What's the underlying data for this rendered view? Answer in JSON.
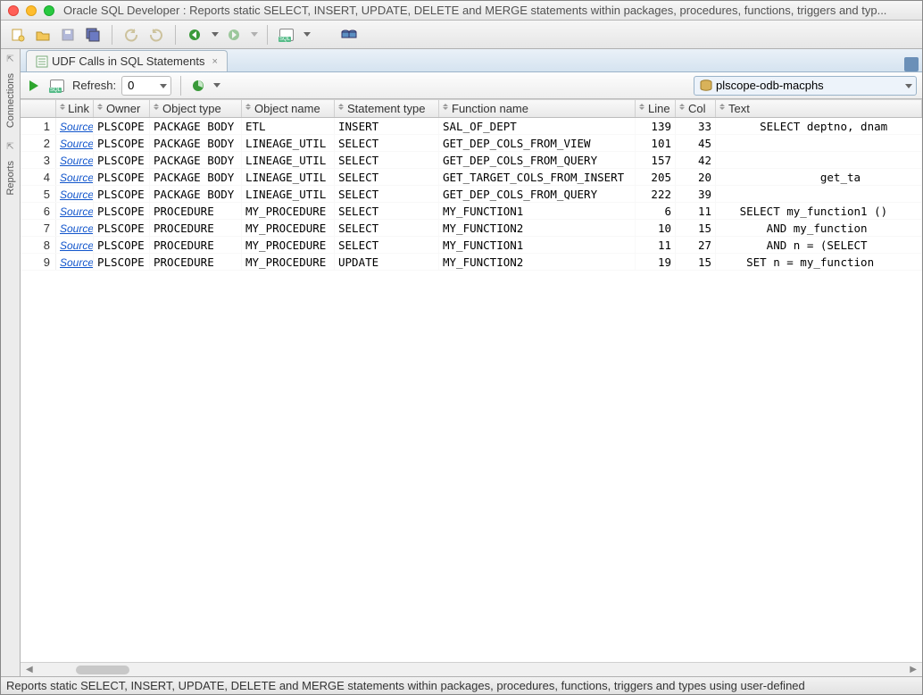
{
  "window_title": "Oracle SQL Developer : Reports static SELECT, INSERT, UPDATE, DELETE and MERGE statements within packages, procedures, functions, triggers and typ...",
  "sidetabs": {
    "connections": "Connections",
    "reports": "Reports"
  },
  "tab": {
    "label": "UDF Calls in SQL Statements"
  },
  "runbar": {
    "refresh_label": "Refresh:",
    "refresh_value": "0",
    "db_selected": "plscope-odb-macphs"
  },
  "columns": {
    "link": "Link",
    "owner": "Owner",
    "object_type": "Object type",
    "object_name": "Object name",
    "statement_type": "Statement type",
    "function_name": "Function name",
    "line": "Line",
    "col": "Col",
    "text": "Text"
  },
  "rows": [
    {
      "n": "1",
      "link": "Source",
      "owner": "PLSCOPE",
      "otype": "PACKAGE BODY",
      "oname": "ETL",
      "stmt": "INSERT",
      "func": "SAL_OF_DEPT",
      "line": "139",
      "col": "33",
      "text": "      SELECT deptno, dnam"
    },
    {
      "n": "2",
      "link": "Source",
      "owner": "PLSCOPE",
      "otype": "PACKAGE BODY",
      "oname": "LINEAGE_UTIL",
      "stmt": "SELECT",
      "func": "GET_DEP_COLS_FROM_VIEW",
      "line": "101",
      "col": "45",
      "text": ""
    },
    {
      "n": "3",
      "link": "Source",
      "owner": "PLSCOPE",
      "otype": "PACKAGE BODY",
      "oname": "LINEAGE_UTIL",
      "stmt": "SELECT",
      "func": "GET_DEP_COLS_FROM_QUERY",
      "line": "157",
      "col": "42",
      "text": ""
    },
    {
      "n": "4",
      "link": "Source",
      "owner": "PLSCOPE",
      "otype": "PACKAGE BODY",
      "oname": "LINEAGE_UTIL",
      "stmt": "SELECT",
      "func": "GET_TARGET_COLS_FROM_INSERT",
      "line": "205",
      "col": "20",
      "text": "               get_ta"
    },
    {
      "n": "5",
      "link": "Source",
      "owner": "PLSCOPE",
      "otype": "PACKAGE BODY",
      "oname": "LINEAGE_UTIL",
      "stmt": "SELECT",
      "func": "GET_DEP_COLS_FROM_QUERY",
      "line": "222",
      "col": "39",
      "text": ""
    },
    {
      "n": "6",
      "link": "Source",
      "owner": "PLSCOPE",
      "otype": "PROCEDURE",
      "oname": "MY_PROCEDURE",
      "stmt": "SELECT",
      "func": "MY_FUNCTION1",
      "line": "6",
      "col": "11",
      "text": "   SELECT my_function1 ()"
    },
    {
      "n": "7",
      "link": "Source",
      "owner": "PLSCOPE",
      "otype": "PROCEDURE",
      "oname": "MY_PROCEDURE",
      "stmt": "SELECT",
      "func": "MY_FUNCTION2",
      "line": "10",
      "col": "15",
      "text": "       AND my_function"
    },
    {
      "n": "8",
      "link": "Source",
      "owner": "PLSCOPE",
      "otype": "PROCEDURE",
      "oname": "MY_PROCEDURE",
      "stmt": "SELECT",
      "func": "MY_FUNCTION1",
      "line": "11",
      "col": "27",
      "text": "       AND n = (SELECT"
    },
    {
      "n": "9",
      "link": "Source",
      "owner": "PLSCOPE",
      "otype": "PROCEDURE",
      "oname": "MY_PROCEDURE",
      "stmt": "UPDATE",
      "func": "MY_FUNCTION2",
      "line": "19",
      "col": "15",
      "text": "    SET n = my_function"
    }
  ],
  "status": "Reports static SELECT, INSERT, UPDATE, DELETE and MERGE statements within packages, procedures, functions, triggers and types using user-defined"
}
